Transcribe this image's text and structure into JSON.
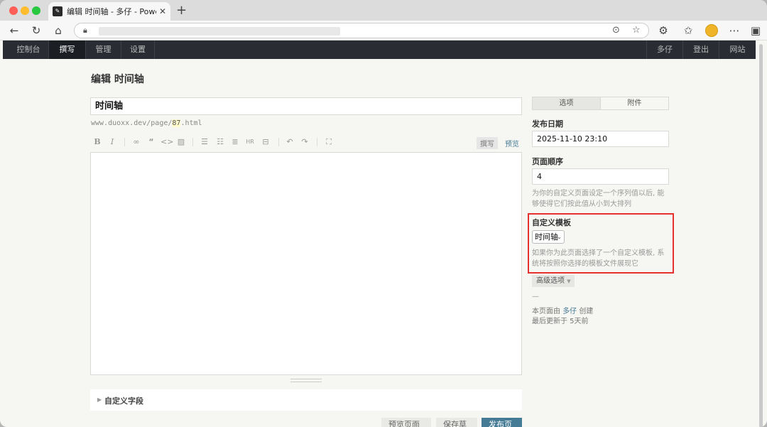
{
  "browser": {
    "tab_title": "编辑 时间轴 - 多仔 - Powered by",
    "tab_favicon_glyph": "✎",
    "icons": [
      "back-arrow-icon",
      "reload-icon",
      "home-icon",
      "lock-icon",
      "reader-icon",
      "favorite-star-icon",
      "extensions-icon",
      "favorites-icon",
      "profile-avatar",
      "more-icon",
      "sidebar-icon"
    ]
  },
  "admin_nav": {
    "left": [
      "控制台",
      "撰写",
      "管理",
      "设置"
    ],
    "right": [
      "多仔",
      "登出",
      "网站"
    ],
    "active": "撰写"
  },
  "page": {
    "title": "编辑 时间轴",
    "post_title": "时间轴",
    "permalink_prefix": "www.duoxx.dev/page/",
    "permalink_slug": "87",
    "permalink_suffix": ".html"
  },
  "editor": {
    "mode_write": "撰写",
    "mode_preview": "预览",
    "content": ""
  },
  "custom_fields": {
    "label": "自定义字段"
  },
  "actions": {
    "preview": "预览页面",
    "save_draft": "保存草稿",
    "publish": "发布页面"
  },
  "sidebar": {
    "tabs": [
      "选项",
      "附件"
    ],
    "active_tab": "选项",
    "publish_date_label": "发布日期",
    "publish_date": "2025-11-10 23:10",
    "order_label": "页面顺序",
    "order_value": "4",
    "order_desc": "为你的自定义页面设定一个序列值以后, 能够使得它们按此值从小到大排列",
    "template_label": "自定义模板",
    "template_selected": "时间轴",
    "template_desc": "如果你为此页面选择了一个自定义模板, 系统将按照你选择的模板文件展现它",
    "advanced_label": "高级选项",
    "meta_dash": "—",
    "meta_created_prefix": "本页面由",
    "meta_author": "多仔",
    "meta_created_suffix": "创建",
    "meta_updated": "最后更新于 5天前"
  },
  "colors": {
    "accent": "#467b96",
    "highlight": "#e5312f",
    "nav_bg": "#292d33"
  }
}
